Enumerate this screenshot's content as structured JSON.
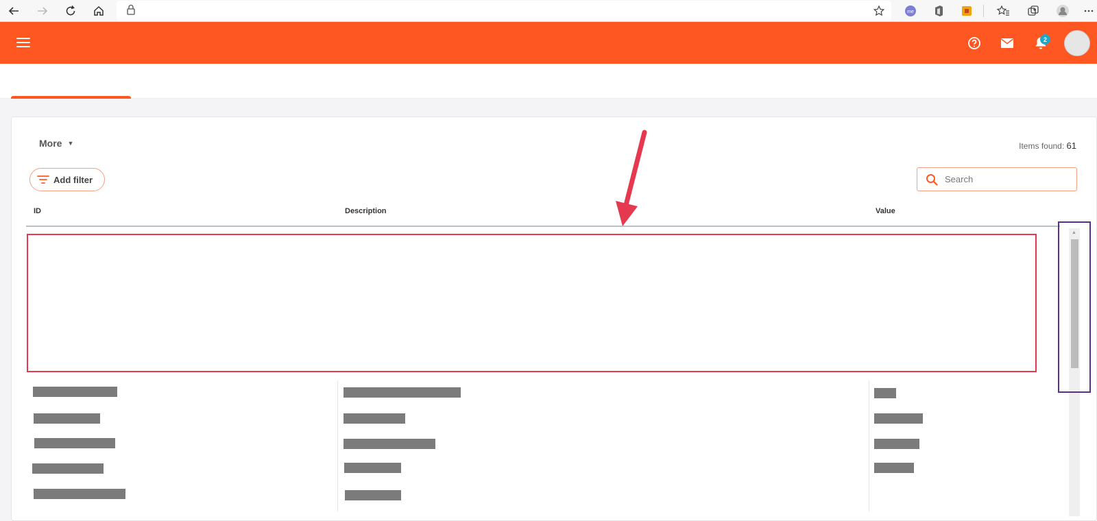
{
  "app_header": {
    "notification_count": "2"
  },
  "toolbar": {
    "more_label": "More",
    "items_found_label": "Items found:",
    "items_found_value": "61",
    "add_filter_label": "Add filter"
  },
  "search": {
    "placeholder": "Search"
  },
  "table": {
    "columns": [
      "ID",
      "Description",
      "Value"
    ]
  },
  "colors": {
    "brand": "#ff5722",
    "annotation_red": "#e53950",
    "annotation_purple": "#5a2d91"
  }
}
